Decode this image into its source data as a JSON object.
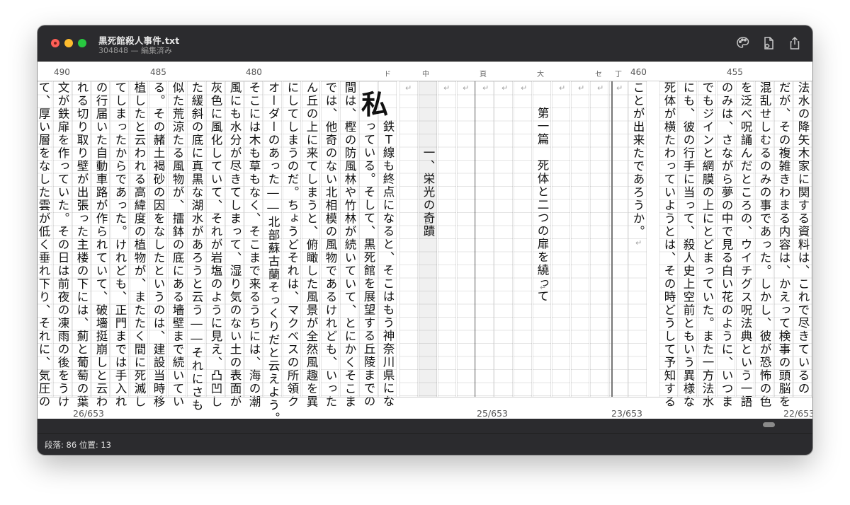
{
  "window": {
    "title": "黒死館殺人事件.txt",
    "subtitle": "304848 — 編集済み"
  },
  "toolbar": {
    "icons": [
      "palette-icon",
      "document-settings-icon",
      "share-icon"
    ]
  },
  "ruler": {
    "numbers": [
      "490",
      "485",
      "480",
      "460",
      "455"
    ],
    "tick_chars": [
      "ド",
      "中",
      "頁",
      "大",
      "セ",
      "丁"
    ]
  },
  "columns": [
    "法水の降矢木家に関する資料は、これで尽きているの",
    "だが、その複雑きわまる内容は、かえって検事の頭脳を",
    "混乱せしむるのみの事であった。しかし、彼が恐怖の色",
    "を泛べ呪誦んだところの、ウイチグス呪法典という一語",
    "のみは、さながら夢の中で見る白い花のように、いつま",
    "でもジインと網膜の上にとどまっていた。また一方法水",
    "にも、彼の行手に当って、殺人史上空前ともいう異様な",
    "死体が横たわっていようとは、その時どうして予知する",
    "ことが出来たであろうか。",
    "第一篇　死体と二つの扉を繞って",
    "一、栄光の奇蹟",
    "鉄Ｔ線も終点になると、そこはもう神奈川県にな",
    "っている。そして、黒死館を展望する丘陵までの",
    "間は、樫の防風林や竹林が続いていて、とにかくそこま",
    "では、他奇のない北相模の風物であるけれども、いった",
    "ん丘の上に来てしまうと、俯瞰した風景が全然風趣を異",
    "にしてしまうのだ。ちょうどそれは、マクベスの所領ク",
    "オーダーのあった――北部蘇古蘭そっくりだと云えよう。",
    "そこには木も草もなく、そこまで来るうちには、海の潮",
    "風にも水分が尽きてしまって、湿り気のない土の表面が",
    "灰色に風化していて、それが岩塩のように見え、凸凹し",
    "た緩斜の底に真黒な湖水があろうと云う――それにさも",
    "似た荒涼たる風物が、擂鉢の底にある墻壁まで続いてい",
    "る。その赭土褐砂の因をなしたというのは、建設当時移",
    "植したと云われる高緯度の植物が、またたく間に死滅し",
    "てしまったからであった。けれども、正門までは手入れ",
    "の行届いた自動車路が作られていて、破墻挺崩しと云わ",
    "れる切り取り壁が出張った主楼の下には、薊と葡萄の葉",
    "文が鉄扉を作っていた。その日は前夜の凍雨の後をうけ",
    "て、厚い層をなした雲が低く垂れ下り、それに、気圧の"
  ],
  "big_character": "私",
  "page_numbers": [
    "26/653",
    "25/653",
    "23/653",
    "22/653"
  ],
  "status": {
    "text": "段落: 86  位置: 13"
  }
}
